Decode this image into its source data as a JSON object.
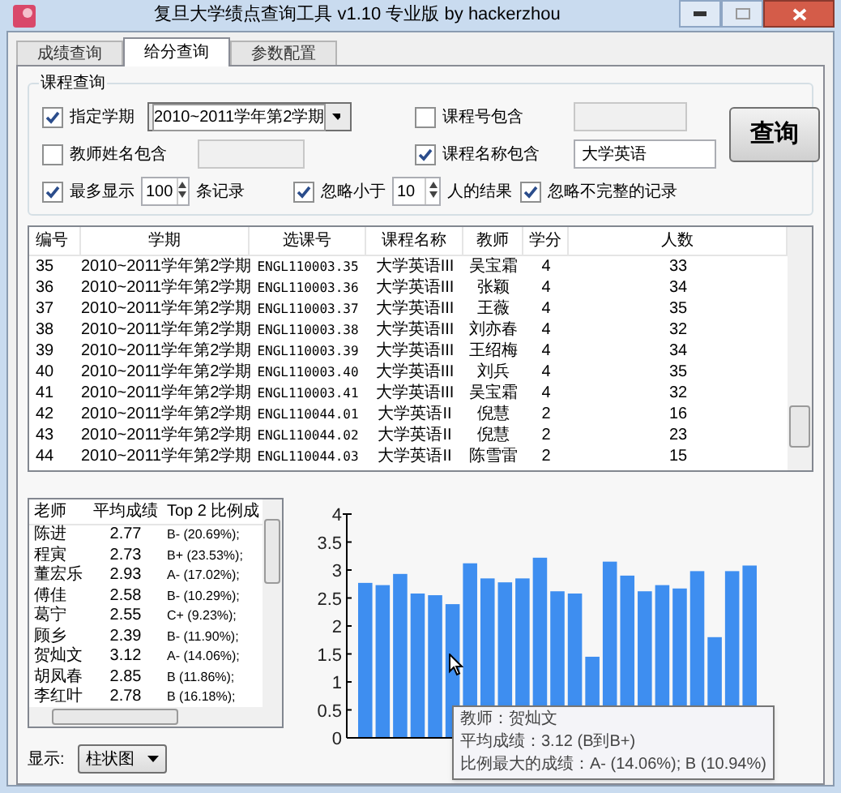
{
  "window": {
    "title": "复旦大学绩点查询工具 v1.10 专业版 by hackerzhou"
  },
  "tabs": [
    {
      "label": "成绩查询",
      "selected": false
    },
    {
      "label": "给分查询",
      "selected": true
    },
    {
      "label": "参数配置",
      "selected": false
    }
  ],
  "query": {
    "title": "课程查询",
    "semester": {
      "label": "指定学期",
      "checked": true,
      "value": "2010~2011学年第2学期"
    },
    "course_no": {
      "label": "课程号包含",
      "checked": false
    },
    "teacher": {
      "label": "教师姓名包含",
      "checked": false
    },
    "course_name": {
      "label": "课程名称包含",
      "checked": true,
      "value": "大学英语"
    },
    "max_show": {
      "label": "最多显示",
      "checked": true,
      "value": "100",
      "suffix": "条记录"
    },
    "min_people": {
      "label": "忽略小于",
      "checked": true,
      "value": "10",
      "suffix": "人的结果"
    },
    "ignore_incomplete": {
      "label": "忽略不完整的记录",
      "checked": true
    },
    "button": "查询"
  },
  "table": {
    "columns": [
      "编号",
      "学期",
      "选课号",
      "课程名称",
      "教师",
      "学分",
      "人数"
    ],
    "rows": [
      [
        "35",
        "2010~2011学年第2学期",
        "ENGL110003.35",
        "大学英语III",
        "吴宝霜",
        "4",
        "33"
      ],
      [
        "36",
        "2010~2011学年第2学期",
        "ENGL110003.36",
        "大学英语III",
        "张颖",
        "4",
        "34"
      ],
      [
        "37",
        "2010~2011学年第2学期",
        "ENGL110003.37",
        "大学英语III",
        "王薇",
        "4",
        "35"
      ],
      [
        "38",
        "2010~2011学年第2学期",
        "ENGL110003.38",
        "大学英语III",
        "刘亦春",
        "4",
        "32"
      ],
      [
        "39",
        "2010~2011学年第2学期",
        "ENGL110003.39",
        "大学英语III",
        "王绍梅",
        "4",
        "34"
      ],
      [
        "40",
        "2010~2011学年第2学期",
        "ENGL110003.40",
        "大学英语III",
        "刘兵",
        "4",
        "35"
      ],
      [
        "41",
        "2010~2011学年第2学期",
        "ENGL110003.41",
        "大学英语III",
        "吴宝霜",
        "4",
        "32"
      ],
      [
        "42",
        "2010~2011学年第2学期",
        "ENGL110044.01",
        "大学英语II",
        "倪慧",
        "2",
        "16"
      ],
      [
        "43",
        "2010~2011学年第2学期",
        "ENGL110044.02",
        "大学英语II",
        "倪慧",
        "2",
        "23"
      ],
      [
        "44",
        "2010~2011学年第2学期",
        "ENGL110044.03",
        "大学英语II",
        "陈雪雷",
        "2",
        "15"
      ]
    ]
  },
  "teacher_list": {
    "columns": [
      "老师",
      "平均成绩",
      "Top 2 比例成"
    ],
    "rows": [
      [
        "陈进",
        "2.77",
        "B- (20.69%);"
      ],
      [
        "程寅",
        "2.73",
        "B+ (23.53%);"
      ],
      [
        "董宏乐",
        "2.93",
        "A- (17.02%);"
      ],
      [
        "傅佳",
        "2.58",
        "B- (10.29%);"
      ],
      [
        "葛宁",
        "2.55",
        "C+ (9.23%);"
      ],
      [
        "顾乡",
        "2.39",
        "B- (11.90%);"
      ],
      [
        "贺灿文",
        "3.12",
        "A- (14.06%);"
      ],
      [
        "胡凤春",
        "2.85",
        "B (11.86%);"
      ],
      [
        "李红叶",
        "2.78",
        "B (16.18%);"
      ]
    ]
  },
  "display": {
    "label": "显示:",
    "value": "柱状图"
  },
  "chart": {
    "chart_data": {
      "type": "bar",
      "values": [
        2.77,
        2.73,
        2.93,
        2.58,
        2.55,
        2.39,
        3.12,
        2.85,
        2.78,
        2.85,
        3.22,
        2.62,
        2.58,
        1.45,
        3.15,
        2.9,
        2.62,
        2.73,
        2.67,
        2.98,
        1.8,
        2.98,
        3.08
      ],
      "ylim": [
        0,
        4
      ],
      "yticks": [
        0,
        0.5,
        1,
        1.5,
        2,
        2.5,
        3,
        3.5,
        4
      ]
    },
    "tooltip": [
      "教师：贺灿文",
      "平均成绩：3.12 (B到B+)",
      "比例最大的成绩：A- (14.06%); B (10.94%)"
    ]
  }
}
